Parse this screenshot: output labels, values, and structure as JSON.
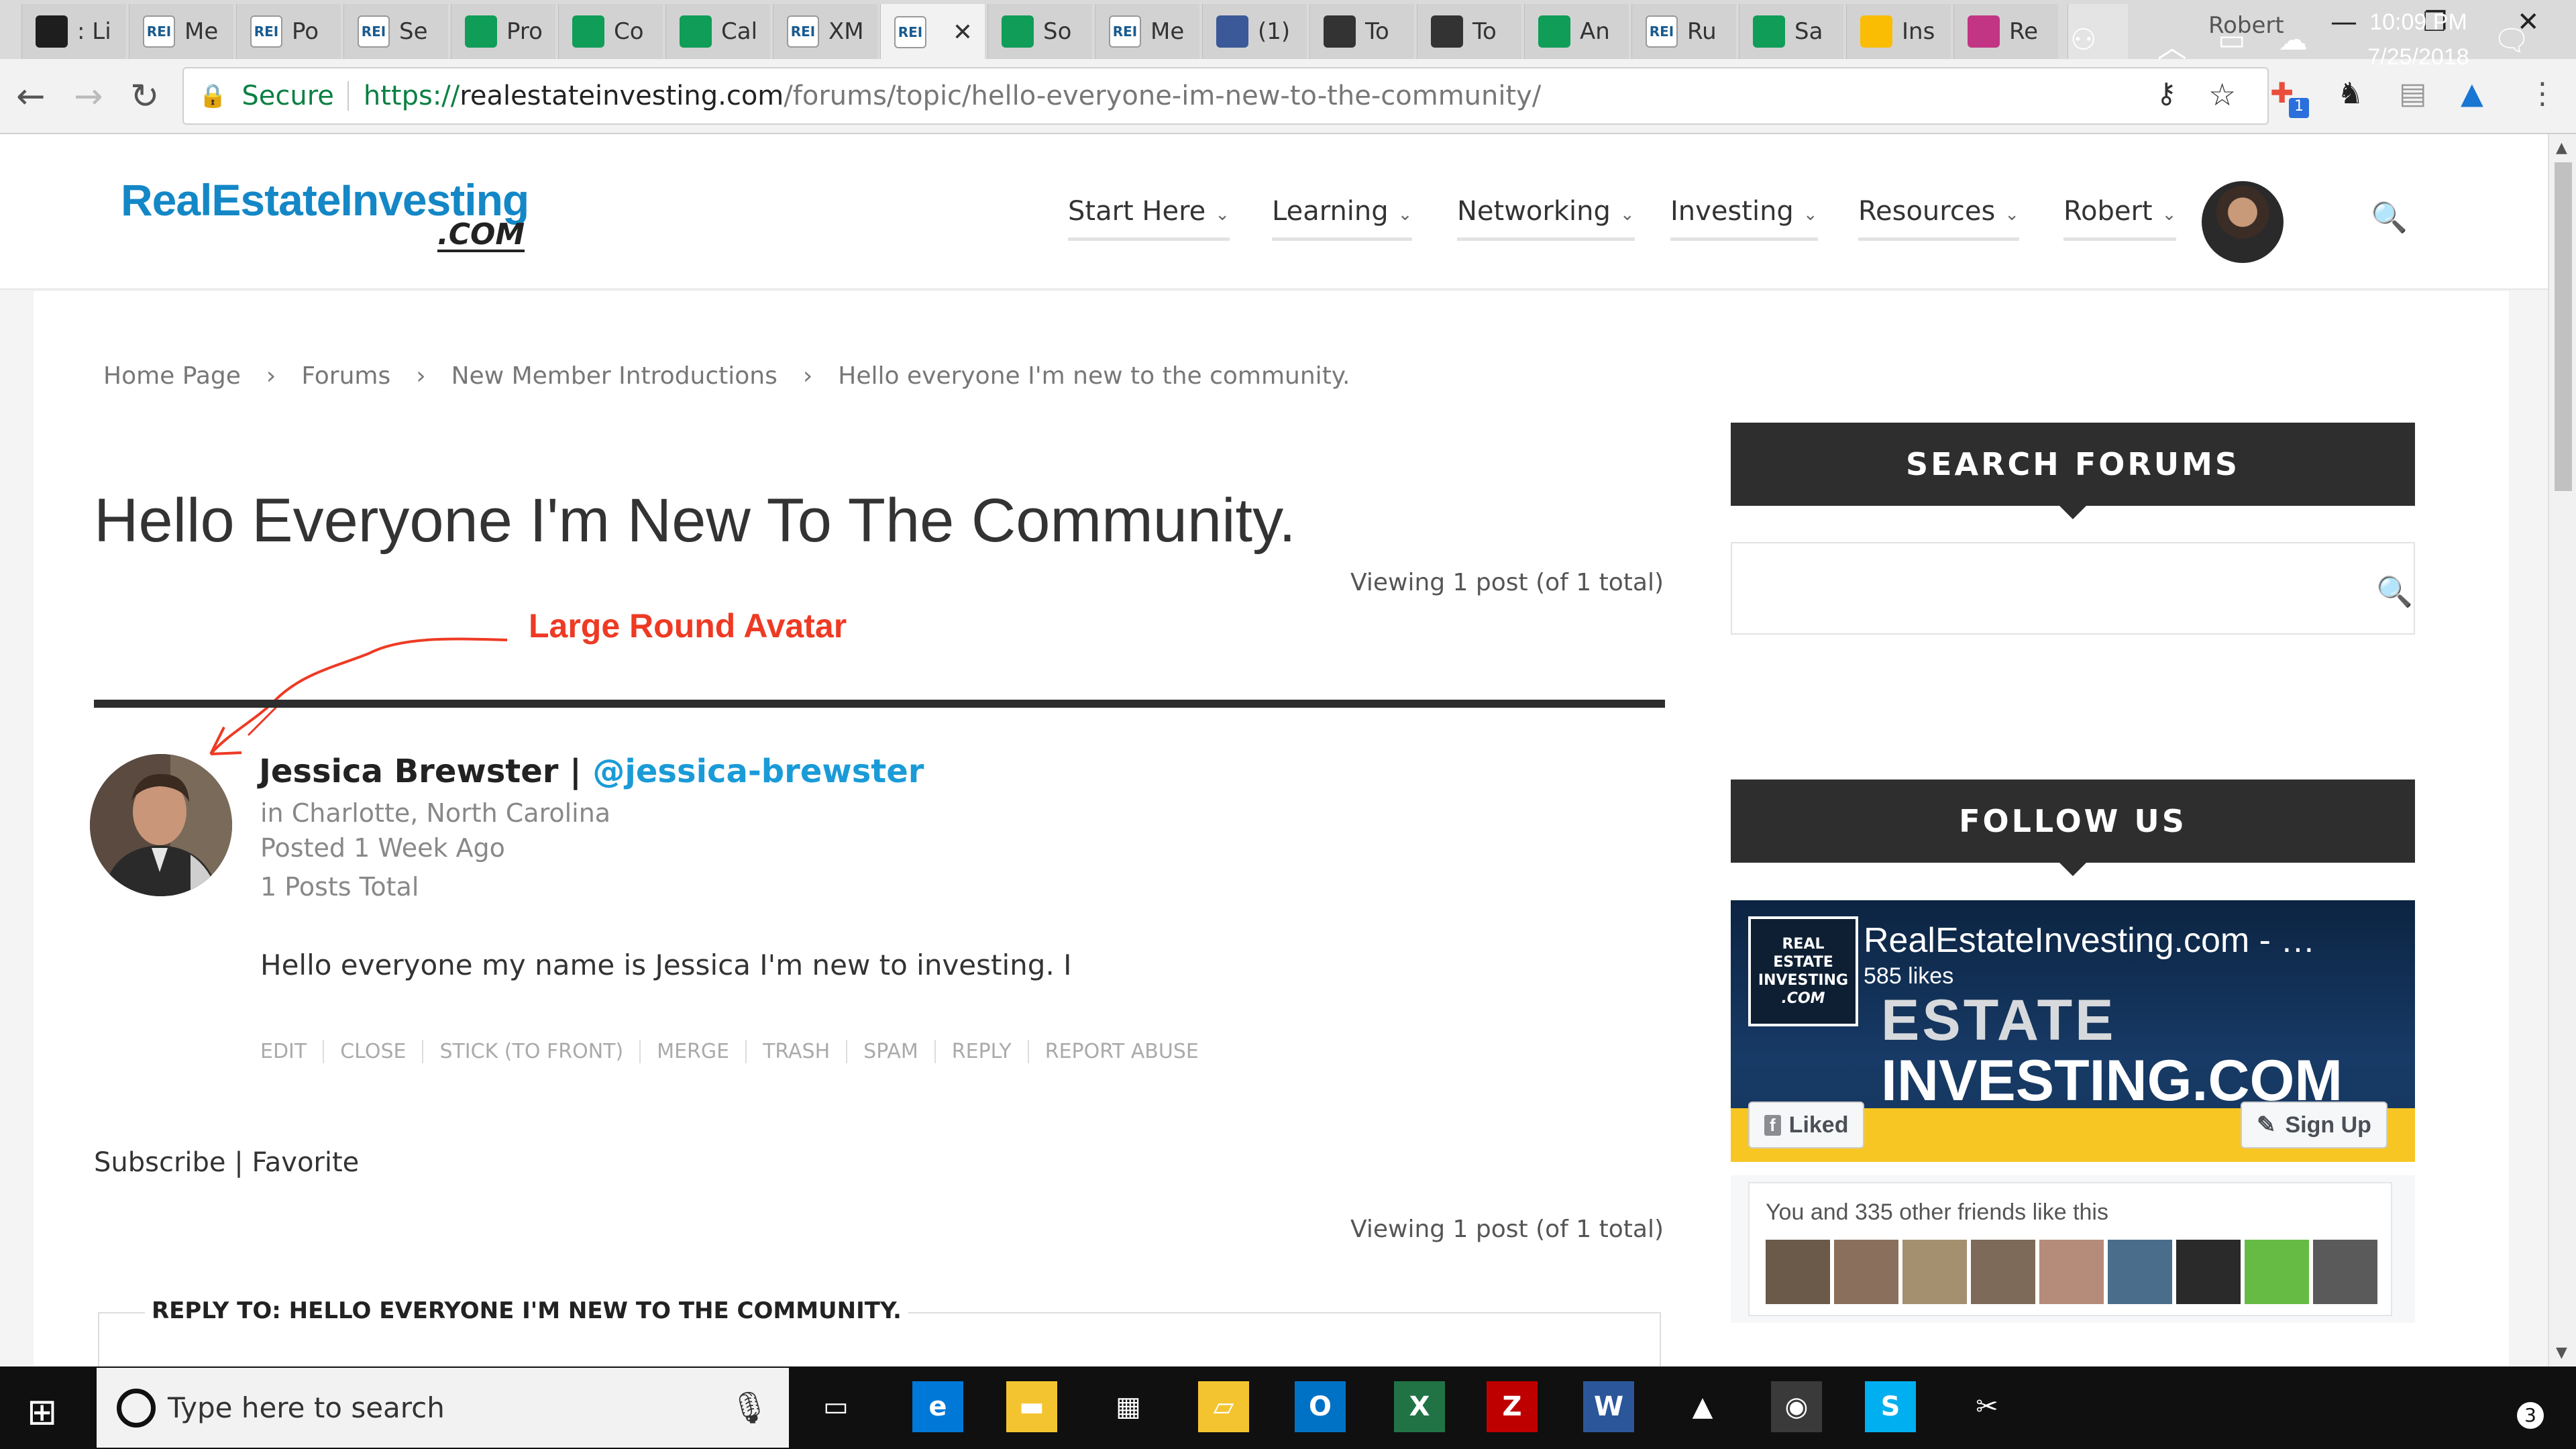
{
  "browser": {
    "tabs": [
      {
        "label": ": Li",
        "icon": "green-leaf-icon",
        "color": "#1e1e1e"
      },
      {
        "label": "Me",
        "icon": "rei-how-icon",
        "color": "#ffffff"
      },
      {
        "label": "Po",
        "icon": "rei-how-icon",
        "color": "#ffffff"
      },
      {
        "label": "Se",
        "icon": "rei-how-icon",
        "color": "#ffffff"
      },
      {
        "label": "Pro",
        "icon": "sheets-icon",
        "color": "#0f9d58"
      },
      {
        "label": "Co",
        "icon": "sheets-icon",
        "color": "#0f9d58"
      },
      {
        "label": "Cal",
        "icon": "sheets-icon",
        "color": "#0f9d58"
      },
      {
        "label": "XM",
        "icon": "document-icon",
        "color": "#ffffff"
      },
      {
        "label": "",
        "icon": "rei-how-icon",
        "color": "#ffffff",
        "active": true
      },
      {
        "label": "So",
        "icon": "sheets-icon",
        "color": "#0f9d58"
      },
      {
        "label": "Me",
        "icon": "rei-how-icon",
        "color": "#ffffff"
      },
      {
        "label": "(1)",
        "icon": "facebook-icon",
        "color": "#3b5998"
      },
      {
        "label": "To",
        "icon": "b-circle-icon",
        "color": "#333333"
      },
      {
        "label": "To",
        "icon": "b-circle-icon",
        "color": "#333333"
      },
      {
        "label": "An",
        "icon": "sheets-icon",
        "color": "#0f9d58"
      },
      {
        "label": "Ru",
        "icon": "rei-how-icon",
        "color": "#ffffff"
      },
      {
        "label": "Sa",
        "icon": "sheets-icon",
        "color": "#0f9d58"
      },
      {
        "label": "Ins",
        "icon": "drive-icon",
        "color": "#fbbc04"
      },
      {
        "label": "Re",
        "icon": "instagram-icon",
        "color": "#c13584"
      }
    ],
    "window_user": "Robert",
    "secure_label": "Secure",
    "url_scheme": "https://",
    "url_domain": "realestateinvesting.com",
    "url_path": "/forums/topic/hello-everyone-im-new-to-the-community/",
    "extension_badge": "1"
  },
  "site": {
    "logo_main": "RealEstateInvesting",
    "logo_com": ".COM",
    "nav": [
      "Start Here",
      "Learning",
      "Networking",
      "Investing",
      "Resources",
      "Robert"
    ]
  },
  "breadcrumb": {
    "items": [
      "Home Page",
      "Forums",
      "New Member Introductions",
      "Hello everyone I'm new to the community."
    ],
    "separator": "›"
  },
  "topic": {
    "title": "Hello Everyone I'm New To The Community.",
    "viewing_top": "Viewing 1 post (of 1 total)",
    "viewing_bottom": "Viewing 1 post (of 1 total)",
    "annotation": "Large Round Avatar"
  },
  "post": {
    "author_name": "Jessica Brewster",
    "name_sep": " | ",
    "author_handle": "@jessica-brewster",
    "location": "in Charlotte, North Carolina",
    "posted": "Posted 1 Week Ago",
    "posts_total": "1 Posts Total",
    "body": "Hello everyone my name is Jessica I'm new to investing. I",
    "admin_links": [
      "EDIT",
      "CLOSE",
      "STICK (TO FRONT)",
      "MERGE",
      "TRASH",
      "SPAM",
      "REPLY",
      "REPORT ABUSE"
    ]
  },
  "actions": {
    "subscribe": "Subscribe",
    "sep": " | ",
    "favorite": "Favorite"
  },
  "reply": {
    "title": "REPLY TO: HELLO EVERYONE I'M NEW TO THE COMMUNITY."
  },
  "sidebar": {
    "search_heading": "SEARCH FORUMS",
    "follow_heading": "FOLLOW US",
    "fb_page_name": "RealEstateInvesting.com - …",
    "fb_likes": "585 likes",
    "fb_logo_lines": [
      "REAL",
      "ESTATE",
      "INVESTING",
      ".COM"
    ],
    "fb_banner_line1": "ESTATE",
    "fb_banner_line2": "INVESTING.COM",
    "fb_liked": "Liked",
    "fb_signup": "Sign Up",
    "fb_friends_text": "You and 335 other friends like this"
  },
  "taskbar": {
    "search_placeholder": "Type here to search",
    "time": "10:09 PM",
    "date": "7/25/2018",
    "notifications": "3",
    "apps": [
      {
        "name": "task-view-icon",
        "color": "#101010"
      },
      {
        "name": "edge-icon",
        "color": "#0078d7"
      },
      {
        "name": "file-explorer-icon",
        "color": "#f4c430"
      },
      {
        "name": "store-icon",
        "color": "#101010"
      },
      {
        "name": "onedrive-folder-icon",
        "color": "#f4c430"
      },
      {
        "name": "outlook-icon",
        "color": "#0072c6"
      },
      {
        "name": "excel-icon",
        "color": "#217346"
      },
      {
        "name": "filezilla-icon",
        "color": "#bf0000"
      },
      {
        "name": "word-icon",
        "color": "#2b579a"
      },
      {
        "name": "photos-icon",
        "color": "#101010"
      },
      {
        "name": "chrome-icon",
        "color": "#3a3a3a"
      },
      {
        "name": "skype-icon",
        "color": "#00aff0"
      },
      {
        "name": "snipping-tool-icon",
        "color": "#101010"
      }
    ]
  },
  "colors": {
    "accent_blue": "#1a9bd7",
    "annotation_red": "#ee3a24",
    "dark_widget": "#2e2e2e"
  }
}
